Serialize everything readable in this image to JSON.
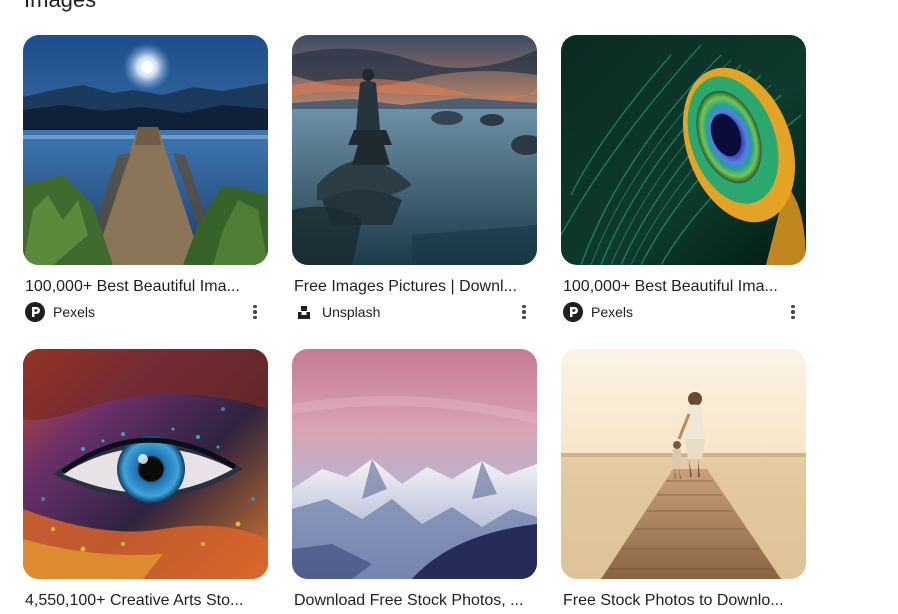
{
  "section": {
    "title": "Images"
  },
  "results": [
    {
      "caption": "100,000+ Best Beautiful Ima...",
      "source": "Pexels",
      "source_icon": "pexels-logo-icon",
      "image": "moonlit-lake-dock-image"
    },
    {
      "caption": "Free Images Pictures | Downl...",
      "source": "Unsplash",
      "source_icon": "unsplash-logo-icon",
      "image": "person-on-rock-sunset-image"
    },
    {
      "caption": "100,000+ Best Beautiful Ima...",
      "source": "Pexels",
      "source_icon": "pexels-logo-icon",
      "image": "peacock-feather-image"
    },
    {
      "caption": "4,550,100+ Creative Arts Sto...",
      "image": "colorful-eye-image"
    },
    {
      "caption": "Download Free Stock Photos, ...",
      "image": "snowy-mountains-pink-sky-image"
    },
    {
      "caption": "Free Stock Photos to Downlo...",
      "image": "mother-child-pier-image"
    }
  ],
  "colors": {
    "text_primary": "#1f1f1f",
    "icon_gray": "#444746"
  }
}
